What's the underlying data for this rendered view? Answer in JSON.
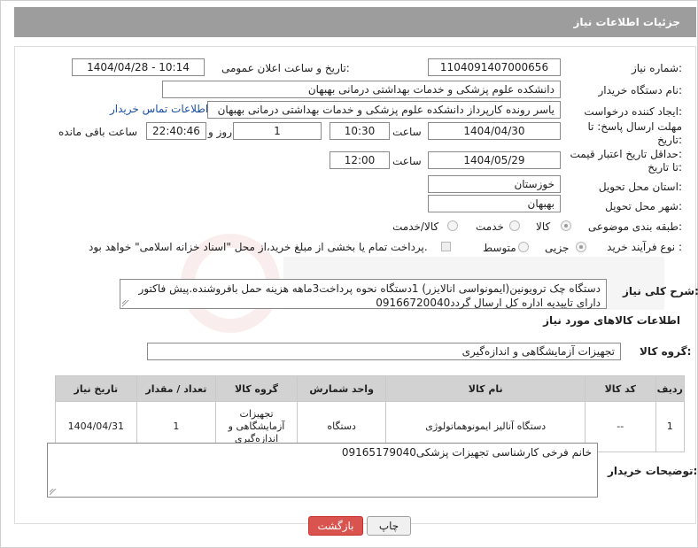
{
  "header": {
    "title": "جزئیات اطلاعات نیاز"
  },
  "fields": {
    "need_number_label": "شماره نیاز:",
    "need_number": "1104091407000656",
    "announce_label": "تاریخ و ساعت اعلان عمومی:",
    "announce_value": "1404/04/28 - 10:14",
    "buyer_org_label": "نام دستگاه خریدار:",
    "buyer_org": "دانشکده علوم پزشکی و خدمات بهداشتی  درمانی بهبهان",
    "creator_label": "ایجاد کننده درخواست:",
    "creator": "یاسر رونده کارپرداز دانشکده علوم پزشکی و خدمات بهداشتی  درمانی بهبهان",
    "contact_link": "اطلاعات تماس خریدار",
    "reply_deadline_label_1": "مهلت ارسال پاسخ: تا",
    "reply_deadline_label_2": "تاریخ:",
    "reply_date": "1404/04/30",
    "time_label": "ساعت",
    "reply_time": "10:30",
    "days_value": "1",
    "days_label": "روز و",
    "remaining_time": "22:40:46",
    "remaining_label": "ساعت باقی مانده",
    "price_valid_label_1": "حداقل تاریخ اعتبار قیمت:",
    "price_valid_label_2": "تا تاریخ:",
    "price_valid_date": "1404/05/29",
    "price_valid_time": "12:00",
    "province_label": "استان محل تحویل:",
    "province": "خوزستان",
    "city_label": "شهر محل تحویل:",
    "city": "بهبهان",
    "category_label": "طبقه بندی موضوعی:",
    "category_options": [
      "کالا",
      "خدمت",
      "کالا/خدمت"
    ],
    "category_selected": "کالا",
    "process_label": "نوع فرآیند خرید :",
    "process_options": [
      "جزیی",
      "متوسط"
    ],
    "process_selected": "جزیی",
    "payment_note": "پرداخت تمام یا بخشی از مبلغ خرید،از محل \"اسناد خزانه اسلامی\" خواهد بود."
  },
  "description": {
    "label": "شرح کلی نیاز:",
    "text": "دستگاه چک ترویونین(ایمونواسی انالایزر) 1دستگاه نحوه پرداخت3ماهه هزینه حمل بافروشنده.پیش فاکتور دارای تاییدیه اداره کل ارسال گردد09166720040"
  },
  "goods": {
    "section_title": "اطلاعات کالاهای مورد نیاز",
    "group_label": "گروه کالا:",
    "group_value": "تجهیزات آزمایشگاهی و اندازه‌گیری",
    "columns": [
      "ردیف",
      "کد کالا",
      "نام کالا",
      "واحد شمارش",
      "گروه کالا",
      "تعداد / مقدار",
      "تاریخ نیاز"
    ],
    "rows": [
      {
        "index": "1",
        "code": "--",
        "name": "دستگاه آنالیز ایمونوهماتولوژی",
        "unit": "دستگاه",
        "group": "تجهیزات آزمایشگاهی و اندازه‌گیری",
        "qty": "1",
        "date": "1404/04/31"
      }
    ]
  },
  "buyer_notes": {
    "label": "توضیحات خریدار:",
    "text": "خانم فرخی کارشناسی تجهیزات پزشکی09165179040"
  },
  "buttons": {
    "back": "بازگشت",
    "print": "چاپ"
  },
  "colors": {
    "header_bg": "#9d9d9d",
    "back_button": "#d9534f",
    "link": "#1a4fa3"
  }
}
